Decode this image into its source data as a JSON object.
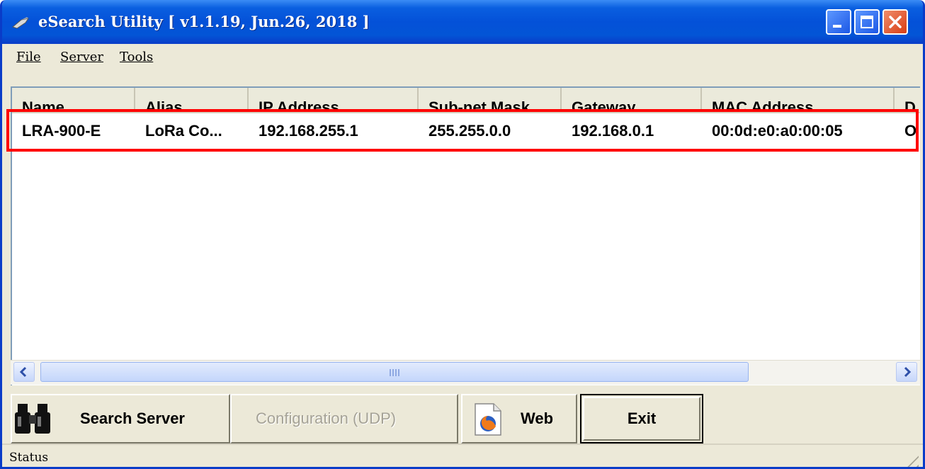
{
  "window": {
    "title": "eSearch Utility [ v1.1.19, Jun.26, 2018 ]"
  },
  "menu": {
    "items": [
      "File",
      "Server",
      "Tools"
    ]
  },
  "table": {
    "columns": [
      "Name",
      "Alias",
      "IP Address",
      "Sub-net Mask",
      "Gateway",
      "MAC Address",
      "D"
    ],
    "rows": [
      [
        "LRA-900-E",
        "LoRa Co...",
        "192.168.255.1",
        "255.255.0.0",
        "192.168.0.1",
        "00:0d:e0:a0:00:05",
        "O"
      ]
    ]
  },
  "buttons": {
    "search_server": "Search Server",
    "configuration": "Configuration (UDP)",
    "web": "Web",
    "exit": "Exit"
  },
  "statusbar": {
    "text": "Status"
  },
  "icons": {
    "app": "app-icon",
    "search": "binoculars-icon",
    "web": "firefox-document-icon",
    "highlight_color": "#ff0000"
  }
}
